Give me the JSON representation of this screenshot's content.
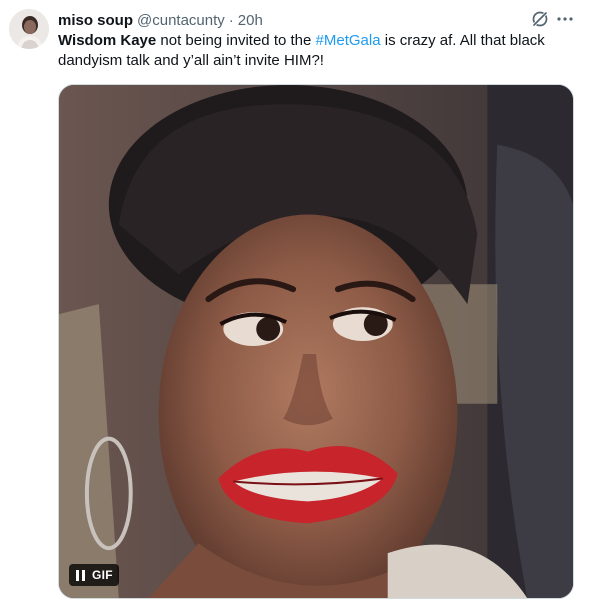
{
  "author": {
    "display_name": "miso soup",
    "handle": "@cuntacunty",
    "separator": "·",
    "time": "20h",
    "avatar_icon": "profile-photo-avatar"
  },
  "tweet": {
    "text_bold": "Wisdom Kaye",
    "text_part1": " not being invited to the ",
    "hashtag": "#MetGala",
    "text_part2": " is crazy af. All that black dandyism talk and y’all ain’t invite HIM?!"
  },
  "media": {
    "type": "gif",
    "badge_label": "GIF",
    "control_icon": "pause-icon"
  },
  "icons": {
    "grok": "grok-icon",
    "more": "more-options-icon"
  },
  "colors": {
    "text": "#0f1419",
    "secondary": "#536471",
    "link": "#1d9bf0",
    "border": "#cfd9de"
  }
}
